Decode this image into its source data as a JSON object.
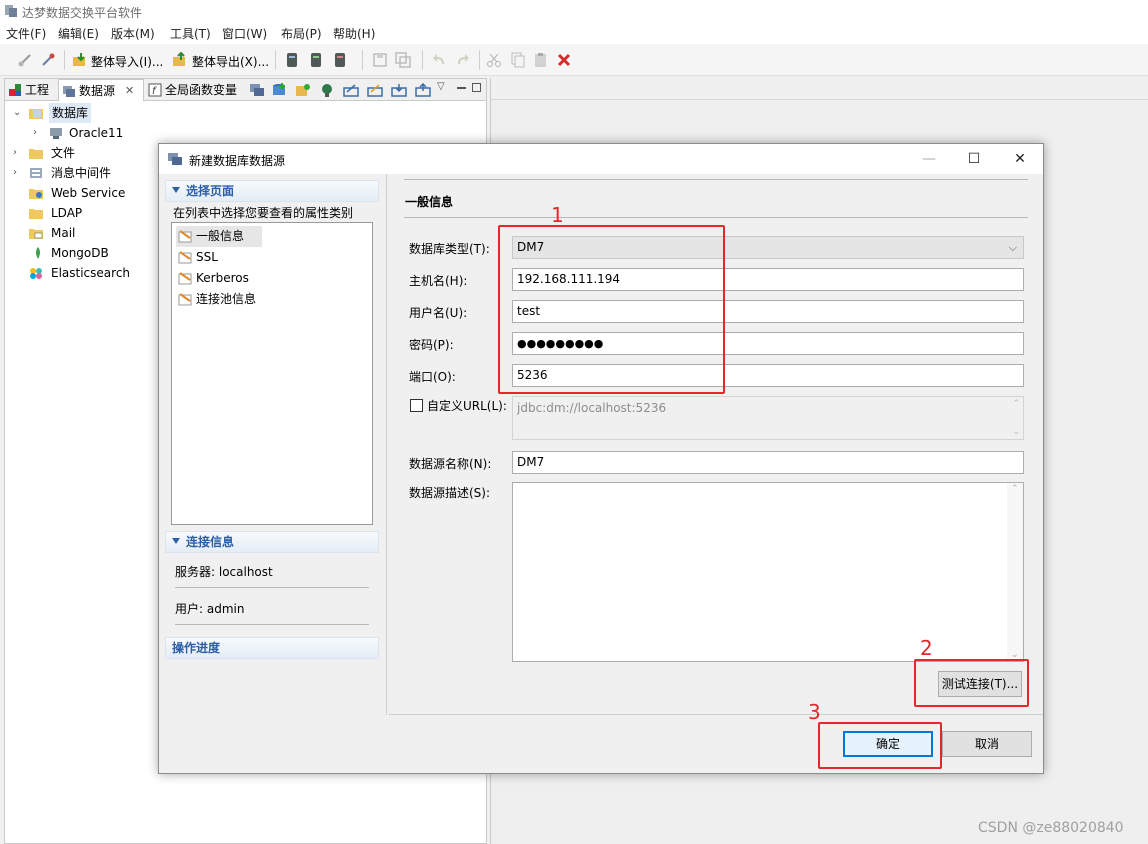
{
  "app": {
    "title": "达梦数据交换平台软件",
    "menu": [
      "文件(F)",
      "编辑(E)",
      "版本(M)",
      "工具(T)",
      "窗口(W)",
      "布局(P)",
      "帮助(H)"
    ],
    "toolbar": {
      "import_label": "整体导入(I)...",
      "export_label": "整体导出(X)..."
    }
  },
  "left_panel": {
    "tabs": {
      "project": "工程",
      "datasource": "数据源",
      "global_vars": "全局函数变量"
    },
    "tree": {
      "database": "数据库",
      "oracle": "Oracle11",
      "file": "文件",
      "mq": "消息中间件",
      "webservice": "Web Service",
      "ldap": "LDAP",
      "mail": "Mail",
      "mongodb": "MongoDB",
      "elasticsearch": "Elasticsearch"
    }
  },
  "dialog": {
    "title": "新建数据库数据源",
    "select_page": {
      "header": "选择页面",
      "hint": "在列表中选择您要查看的属性类别",
      "items": [
        "一般信息",
        "SSL",
        "Kerberos",
        "连接池信息"
      ]
    },
    "conn_info": {
      "header": "连接信息",
      "server": "服务器: localhost",
      "user": "用户: admin"
    },
    "progress": {
      "header": "操作进度"
    },
    "section_title": "一般信息",
    "fields": {
      "db_type_label": "数据库类型(T):",
      "db_type_value": "DM7",
      "host_label": "主机名(H):",
      "host_value": "192.168.111.194",
      "user_label": "用户名(U):",
      "user_value": "test",
      "password_label": "密码(P):",
      "password_value": "●●●●●●●●●",
      "port_label": "端口(O):",
      "port_value": "5236",
      "custom_url_label": "自定义URL(L):",
      "custom_url_value": "jdbc:dm://localhost:5236",
      "ds_name_label": "数据源名称(N):",
      "ds_name_value": "DM7",
      "ds_desc_label": "数据源描述(S):",
      "ds_desc_value": ""
    },
    "buttons": {
      "test": "测试连接(T)...",
      "ok": "确定",
      "cancel": "取消"
    }
  },
  "annotations": {
    "n1": "1",
    "n2": "2",
    "n3": "3",
    "color": "#e5262a"
  },
  "watermark": "CSDN @ze88020840"
}
